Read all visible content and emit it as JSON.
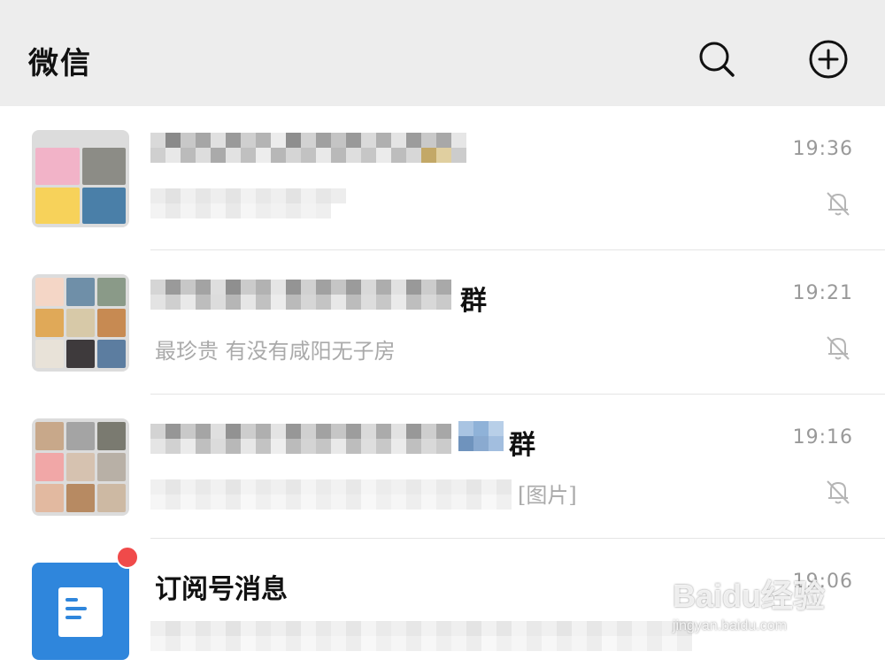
{
  "header": {
    "title": "微信",
    "search_icon": "search-icon",
    "add_icon": "plus-circle-icon"
  },
  "chats": [
    {
      "name": "",
      "preview": "",
      "time": "19:36",
      "muted": true,
      "avatar": "group-grid-4"
    },
    {
      "name": "群",
      "preview": "最珍贵  有没有咸阳无子房",
      "time": "19:21",
      "muted": true,
      "avatar": "group-grid-9"
    },
    {
      "name": "群",
      "preview": "[图片]",
      "time": "19:16",
      "muted": true,
      "avatar": "group-grid-9"
    },
    {
      "name": "订阅号消息",
      "preview": "",
      "time": "19:06",
      "muted": false,
      "unread_dot": true,
      "avatar": "subscription-doc-icon"
    }
  ],
  "colors": {
    "header_bg": "#ededed",
    "subscription_blue": "#2f86dc",
    "unread_red": "#f04a4a",
    "time_gray": "#999999"
  },
  "watermark": {
    "logo": "Baidu经验",
    "url": "jingyan.baidu.com"
  }
}
